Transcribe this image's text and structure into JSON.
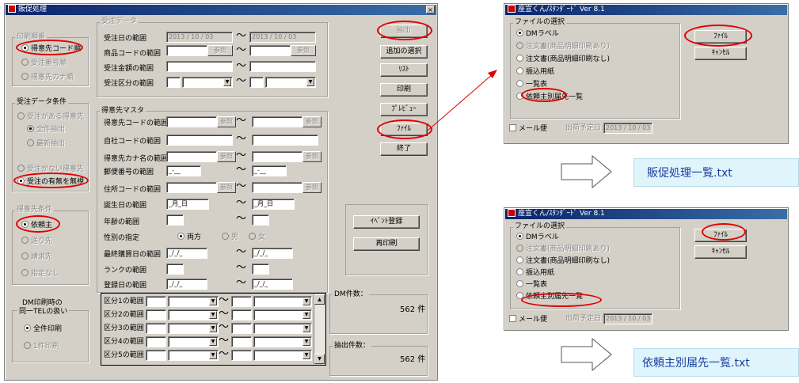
{
  "main_window": {
    "title": "販促処理",
    "close_glyph": "×",
    "print_order": {
      "title": "印刷順番",
      "options": [
        "得意先コード順",
        "受注番号順",
        "得意先カナ順"
      ],
      "selected": 0
    },
    "order_condition": {
      "title": "受注データ条件",
      "option_with_orders": "受注がある得意先",
      "sub_all": "全件抽出",
      "sub_latest": "最新抽出",
      "option_without_orders": "受注がない得意先",
      "option_ignore": "受注の有無を無視"
    },
    "customer_condition": {
      "title": "得意先条件",
      "options": [
        "依頼主",
        "送り先",
        "請求先",
        "指定なし"
      ],
      "selected": 0
    },
    "dm_tel": {
      "title_line1": "DM印刷時の",
      "title_line2": "同一TELの扱い",
      "options": [
        "全件印刷",
        "1件印刷"
      ],
      "selected": 0
    },
    "order_data": {
      "title": "受注データ",
      "date_label": "受注日の範囲",
      "date_from": "2013 / 10 / 03",
      "date_to": "2013 / 10 / 03",
      "product_label": "商品コードの範囲",
      "amount_label": "受注金額の範囲",
      "category_label": "受注区分の範囲",
      "ref_label": "参照",
      "tilde": "～"
    },
    "customer_master": {
      "title": "得意先マスタ",
      "code_label": "得意先コードの範囲",
      "company_label": "自社コードの範囲",
      "kana_label": "得意先カナ名の範囲",
      "zip_label": "郵便番号の範囲",
      "zip_value": "_-__",
      "address_label": "住所コードの範囲",
      "birthday_label": "誕生日の範囲",
      "birthday_value": "_月_日",
      "age_label": "年齢の範囲",
      "gender_label": "性別の指定",
      "gender_options": [
        "両方",
        "男",
        "女"
      ],
      "gender_selected": 0,
      "last_purchase_label": "最終購買日の範囲",
      "date_mask": "_/_/_",
      "rank_label": "ランクの範囲",
      "registered_label": "登録日の範囲",
      "segments": [
        "区分1の範囲",
        "区分2の範囲",
        "区分3の範囲",
        "区分4の範囲",
        "区分5の範囲"
      ]
    },
    "buttons": {
      "extract": "抽出",
      "add_select": "追加の選択",
      "list": "ﾘｽﾄ",
      "print": "印刷",
      "preview": "ﾌﾟﾚﾋﾞｭｰ",
      "file": "ﾌｧｲﾙ",
      "exit": "終了",
      "event_register": "ｲﾍﾞﾝﾄ登録",
      "reprint": "再印刷"
    },
    "counts": {
      "dm_label": "DM件数：",
      "dm_value": "562 件",
      "extract_label": "抽出件数：",
      "extract_value": "562 件"
    }
  },
  "dialogs": [
    {
      "title": "座宣くん/ｽﾀﾝﾀﾞｰﾄﾞ Ver 8.1",
      "group_title": "ファイルの選択",
      "options": [
        "DMラベル",
        "注文書(商品明細印刷あり)",
        "注文書(商品明細印刷なし)",
        "振込用紙",
        "一覧表",
        "依頼主別届先一覧"
      ],
      "disabled": [
        false,
        true,
        false,
        false,
        false,
        false
      ],
      "selected": 0,
      "file_button": "ﾌｧｲﾙ",
      "cancel_button": "ｷｬﾝｾﾙ",
      "mail_label": "メール便",
      "ship_label": "出荷予定日:",
      "ship_date": "2013 / 10 / 03"
    },
    {
      "title": "座宣くん/ｽﾀﾝﾀﾞｰﾄﾞ Ver 8.1",
      "group_title": "ファイルの選択",
      "options": [
        "DMラベル",
        "注文書(商品明細印刷あり)",
        "注文書(商品明細印刷なし)",
        "振込用紙",
        "一覧表",
        "依頼主別届先一覧"
      ],
      "disabled": [
        false,
        true,
        false,
        false,
        false,
        false
      ],
      "selected": 0,
      "file_button": "ﾌｧｲﾙ",
      "cancel_button": "ｷｬﾝｾﾙ",
      "mail_label": "メール便",
      "ship_label": "出荷予定日:",
      "ship_date": "2013 / 10 / 03"
    }
  ],
  "outputs": {
    "file1": "販促処理一覧.txt",
    "file2": "依頼主別届先一覧.txt"
  },
  "colors": {
    "window_bg": "#d4d0c8",
    "title_gradient_start": "#0a246a",
    "highlight": "#e00000",
    "file_box_bg": "#dff4fb",
    "file_box_text": "#1a3fa0"
  }
}
